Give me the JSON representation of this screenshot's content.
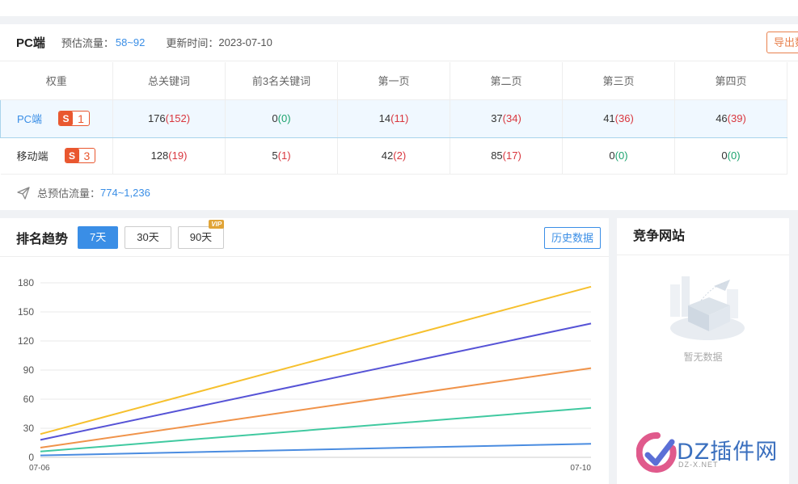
{
  "stats": {
    "title": "PC端",
    "traffic_label": "预估流量：",
    "traffic_value": "58~92",
    "update_label": "更新时间：",
    "update_value": "2023-07-10",
    "export_label": "导出数",
    "columns": [
      "权重",
      "总关键词",
      "前3名关键词",
      "第一页",
      "第二页",
      "第三页",
      "第四页"
    ],
    "rows": [
      {
        "device": "PC端",
        "weight": "1",
        "cells": [
          [
            "176",
            "152"
          ],
          [
            "0",
            "0"
          ],
          [
            "14",
            "11"
          ],
          [
            "37",
            "34"
          ],
          [
            "41",
            "36"
          ],
          [
            "46",
            "39"
          ]
        ]
      },
      {
        "device": "移动端",
        "weight": "3",
        "cells": [
          [
            "128",
            "19"
          ],
          [
            "5",
            "1"
          ],
          [
            "42",
            "2"
          ],
          [
            "85",
            "17"
          ],
          [
            "0",
            "0"
          ],
          [
            "0",
            "0"
          ]
        ]
      }
    ],
    "total_label": "总预估流量：",
    "total_value": "774~1,236"
  },
  "trend": {
    "title": "排名趋势",
    "ranges": [
      "7天",
      "30天",
      "90天"
    ],
    "active_range": "7天",
    "vip_tag": "VIP",
    "history_label": "历史数据"
  },
  "compete": {
    "title": "竞争网站",
    "empty_text": "暂无数据"
  },
  "watermark": {
    "text": "DZ插件网",
    "sub": "DZ-X.NET"
  },
  "chart_data": {
    "type": "line",
    "x": [
      "07-06",
      "07-10"
    ],
    "yticks": [
      0,
      30,
      60,
      90,
      120,
      150,
      180
    ],
    "ylim": [
      0,
      180
    ],
    "grid": true,
    "series": [
      {
        "color": "#f6c02d",
        "values": [
          24,
          176
        ]
      },
      {
        "color": "#5653d6",
        "values": [
          18,
          138
        ]
      },
      {
        "color": "#f0934a",
        "values": [
          10,
          92
        ]
      },
      {
        "color": "#40c9a0",
        "values": [
          6,
          51
        ]
      },
      {
        "color": "#4a8ce0",
        "values": [
          2,
          14
        ]
      }
    ]
  }
}
